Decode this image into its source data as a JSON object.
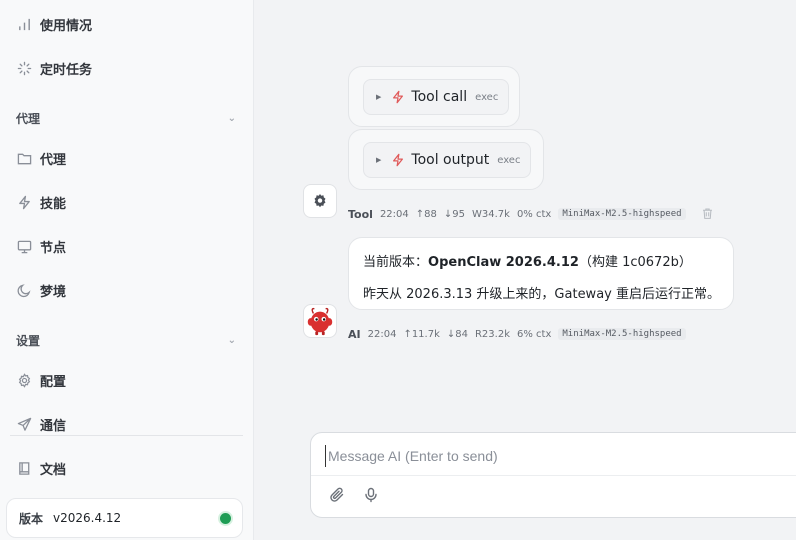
{
  "sidebar": {
    "items_top": [
      {
        "label": "使用情况",
        "icon": "bar-chart-icon"
      },
      {
        "label": "定时任务",
        "icon": "loader-icon"
      }
    ],
    "section_agent": {
      "title": "代理",
      "items": [
        {
          "label": "代理",
          "icon": "folder-icon"
        },
        {
          "label": "技能",
          "icon": "bolt-icon"
        },
        {
          "label": "节点",
          "icon": "monitor-icon"
        },
        {
          "label": "梦境",
          "icon": "moon-icon"
        }
      ]
    },
    "section_settings": {
      "title": "设置",
      "items": [
        {
          "label": "配置",
          "icon": "gear-icon"
        },
        {
          "label": "通信",
          "icon": "send-icon"
        }
      ]
    },
    "docs": {
      "label": "文档",
      "icon": "book-icon"
    },
    "version": {
      "label": "版本",
      "value": "v2026.4.12",
      "status_color": "#1f9d55"
    }
  },
  "chat": {
    "tool_call": {
      "name": "Tool call",
      "tag": "exec"
    },
    "tool_output": {
      "name": "Tool output",
      "tag": "exec"
    },
    "tool_meta": {
      "who": "Tool",
      "time": "22:04",
      "up": "↑88",
      "down": "↓95",
      "w": "W34.7k",
      "ctx": "0% ctx",
      "model": "MiniMax-M2.5-highspeed"
    },
    "ai_message": {
      "line1_prefix": "当前版本：",
      "line1_bold": "OpenClaw 2026.4.12",
      "line1_suffix": "（构建 1c0672b）",
      "line2": "昨天从 2026.3.13 升级上来的，Gateway 重启后运行正常。"
    },
    "ai_meta": {
      "who": "AI",
      "time": "22:04",
      "up": "↑11.7k",
      "down": "↓84",
      "r": "R23.2k",
      "ctx": "6% ctx",
      "model": "MiniMax-M2.5-highspeed"
    }
  },
  "composer": {
    "placeholder": "Message AI (Enter to send)",
    "value": ""
  },
  "colors": {
    "accent_bolt": "#e05a5a",
    "avatar_red": "#d93030"
  }
}
